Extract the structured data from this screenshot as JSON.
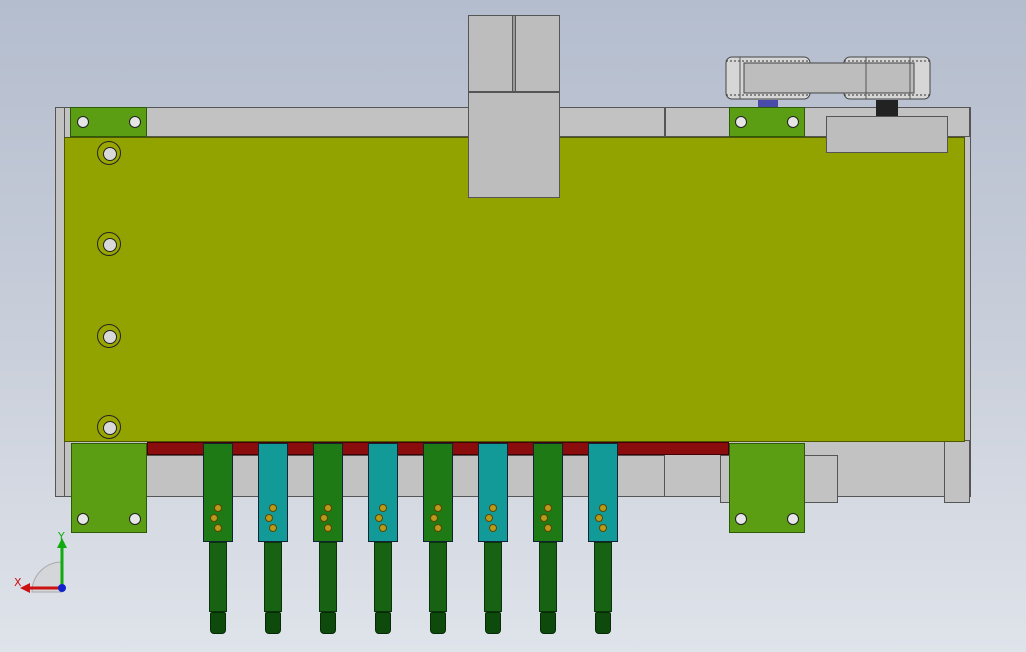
{
  "viewport": {
    "background_top": "#b4bdce",
    "background_bottom": "#dfe3ea"
  },
  "triad": {
    "x_label": "X",
    "y_label": "Y",
    "x_color": "#cc1111",
    "y_color": "#11aa11",
    "z_color": "#1122cc"
  },
  "colors": {
    "plate": "#92a300",
    "bracket": "#5b9e14",
    "finger_green": "#1e7a14",
    "finger_teal": "#129a98",
    "red_strip": "#8a0c0c",
    "frame": "#c2c2c2"
  },
  "fingers": [
    {
      "variant": "green"
    },
    {
      "variant": "teal"
    },
    {
      "variant": "green"
    },
    {
      "variant": "teal"
    },
    {
      "variant": "green"
    },
    {
      "variant": "teal"
    },
    {
      "variant": "green"
    },
    {
      "variant": "teal"
    }
  ]
}
